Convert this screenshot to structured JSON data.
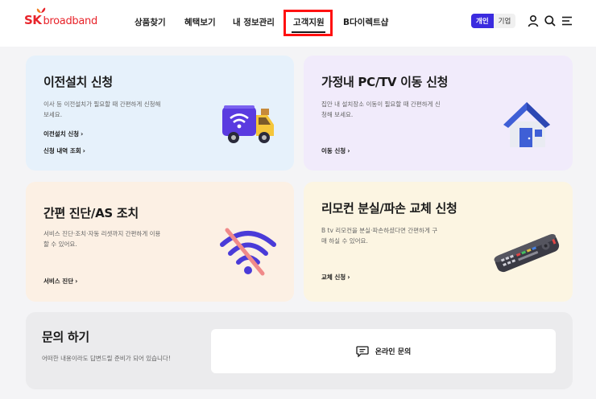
{
  "brand": {
    "sk": "SK",
    "name": "broadband"
  },
  "nav": {
    "items": [
      "상품찾기",
      "혜택보기",
      "내 정보관리",
      "고객지원",
      "B다이렉트샵"
    ],
    "active": "고객지원"
  },
  "header": {
    "segment": {
      "personal": "개인",
      "business": "기업"
    },
    "icons": [
      "user-icon",
      "search-icon",
      "menu-icon"
    ]
  },
  "cards": [
    {
      "title": "이전설치 신청",
      "desc": "이사 등 이전설치가 필요할 때 간편하게 신청해 보세요.",
      "links": [
        "이전설치 신청",
        "신청 내역 조회"
      ],
      "bg": "#e6f1fb",
      "icon": "delivery-truck-icon"
    },
    {
      "title": "가정내 PC/TV 이동 신청",
      "desc": "집안 내 설치장소 이동이 필요할 때 간편하게 신청해 보세요.",
      "links": [
        "이동 신청"
      ],
      "bg": "#f1ebfb",
      "icon": "house-icon"
    },
    {
      "title": "간편 진단/AS 조치",
      "desc": "서비스 진단·조치·자동 리셋까지 간편하게 이용 할 수 있어요.",
      "links": [
        "서비스 진단"
      ],
      "bg": "#fcf0e4",
      "icon": "wifi-off-icon"
    },
    {
      "title": "리모컨 분실/파손 교체 신청",
      "desc": "B tv 리모컨을 분실·파손하셨다면 간편하게 구매 하실 수 있어요.",
      "links": [
        "교체 신청"
      ],
      "bg": "#fcf5e2",
      "icon": "remote-control-icon"
    }
  ],
  "inquiry": {
    "title": "문의 하기",
    "desc": "어떠한 내용이라도 답변드릴 준비가 되어 있습니다!",
    "button": "온라인 문의"
  },
  "colors": {
    "brand": "#e8232a",
    "accent": "#3b2bdf",
    "highlight": "#ff1010"
  }
}
